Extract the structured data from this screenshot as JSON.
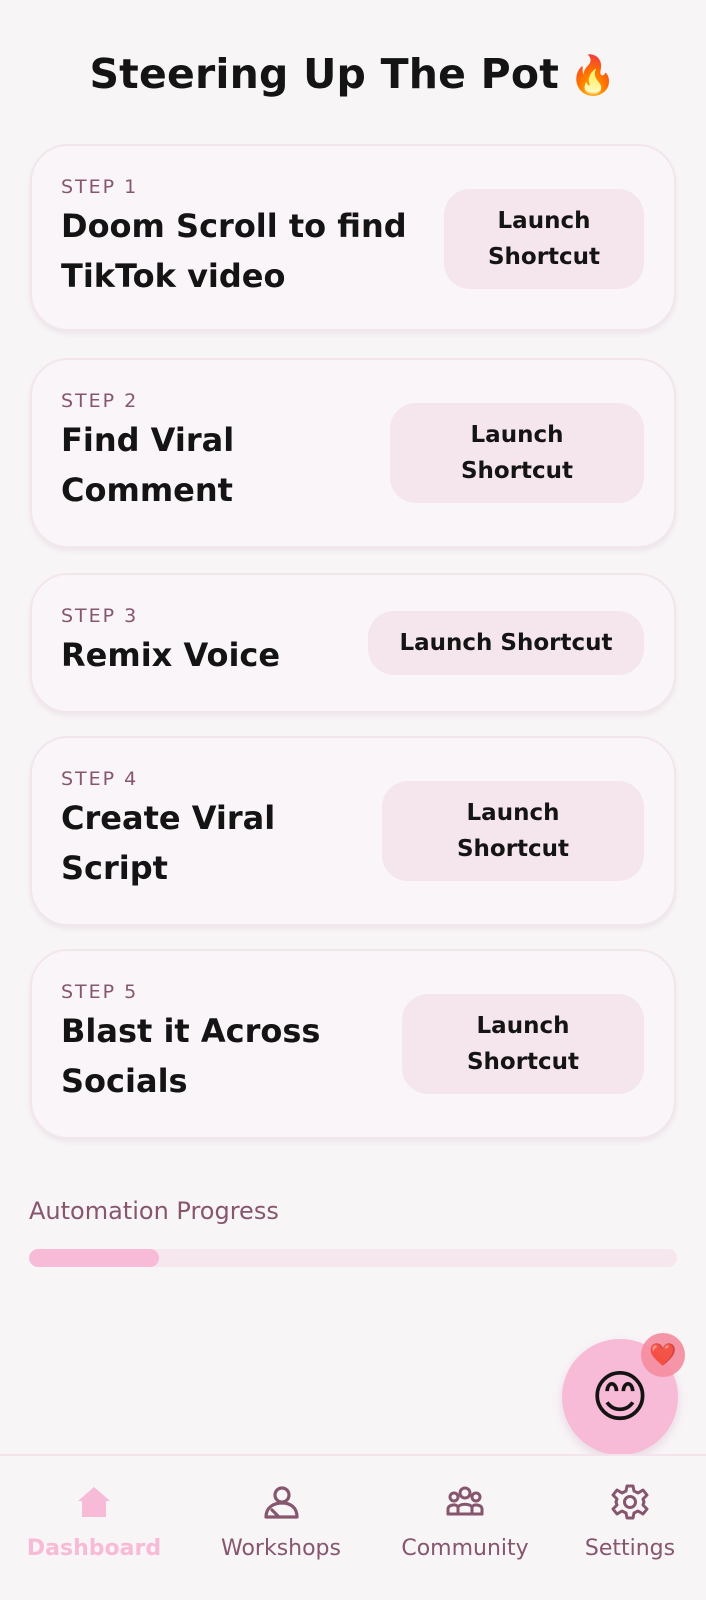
{
  "header": {
    "title": "Steering Up The Pot",
    "title_emoji": "🔥"
  },
  "steps": [
    {
      "step_label": "STEP 1",
      "title_lines": [
        "Doom Scroll to find",
        "TikTok video"
      ],
      "button_lines": [
        "Launch",
        "Shortcut"
      ]
    },
    {
      "step_label": "STEP 2",
      "title_lines": [
        "Find Viral",
        "Comment"
      ],
      "button_lines": [
        "Launch",
        "Shortcut"
      ]
    },
    {
      "step_label": "STEP 3",
      "title_lines": [
        "Remix Voice"
      ],
      "button_lines": [
        "Launch Shortcut"
      ]
    },
    {
      "step_label": "STEP 4",
      "title_lines": [
        "Create Viral",
        "Script"
      ],
      "button_lines": [
        "Launch",
        "Shortcut"
      ]
    },
    {
      "step_label": "STEP 5",
      "title_lines": [
        "Blast it Across",
        "Socials"
      ],
      "button_lines": [
        "Launch",
        "Shortcut"
      ]
    }
  ],
  "progress": {
    "label": "Automation Progress",
    "value_fraction": 0.2
  },
  "fab": {
    "emoji": "😊",
    "badge_emoji": "❤️"
  },
  "tabbar": {
    "active": "dashboard",
    "tabs": [
      {
        "id": "dashboard",
        "label": "Dashboard",
        "icon": "home-icon"
      },
      {
        "id": "workshops",
        "label": "Workshops",
        "icon": "person-icon"
      },
      {
        "id": "community",
        "label": "Community",
        "icon": "group-icon"
      },
      {
        "id": "settings",
        "label": "Settings",
        "icon": "gear-icon"
      }
    ]
  },
  "colors": {
    "background": "#f8f5f7",
    "accent_pink": "#f7bad7",
    "button_bg": "#f5e5ed",
    "muted_text": "#86566f",
    "progress_track": "#f6e6ee"
  }
}
